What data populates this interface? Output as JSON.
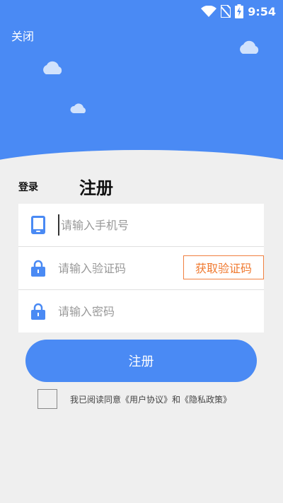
{
  "status_bar": {
    "time": "9:54"
  },
  "header": {
    "close_label": "关闭"
  },
  "tabs": {
    "login_label": "登录",
    "register_label": "注册"
  },
  "form": {
    "phone_placeholder": "请输入手机号",
    "code_placeholder": "请输入验证码",
    "get_code_label": "获取验证码",
    "password_placeholder": "请输入密码"
  },
  "actions": {
    "register_label": "注册"
  },
  "agreement": {
    "text": "我已阅读同意《用户协议》和《隐私政策》"
  },
  "colors": {
    "primary": "#4a8af4",
    "accent": "#f07a30",
    "background": "#efefef"
  },
  "icons": [
    "wifi-icon",
    "no-sim-icon",
    "battery-charging-icon",
    "phone-icon",
    "lock-icon",
    "cloud-icon"
  ]
}
